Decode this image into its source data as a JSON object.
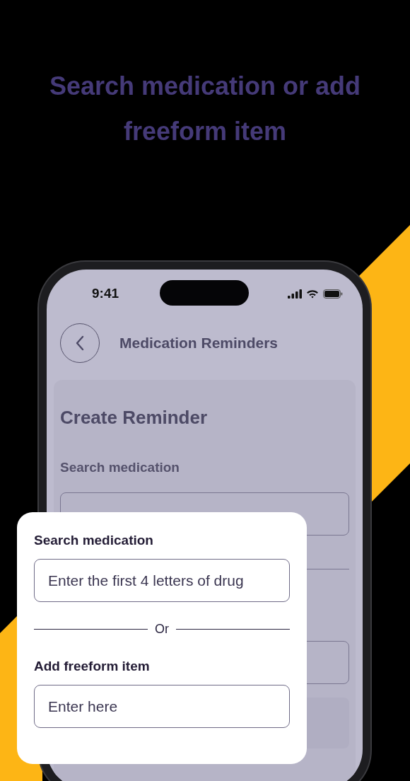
{
  "headline": "Search medication or add freeform item",
  "status_bar": {
    "time": "9:41"
  },
  "app_bar": {
    "title": "Medication Reminders"
  },
  "form": {
    "title": "Create Reminder",
    "search_label": "Search medication"
  },
  "popup": {
    "search_label": "Search medication",
    "search_placeholder": "Enter the first 4 letters of drug",
    "divider_text": "Or",
    "freeform_label": "Add freeform item",
    "freeform_placeholder": "Enter here"
  }
}
